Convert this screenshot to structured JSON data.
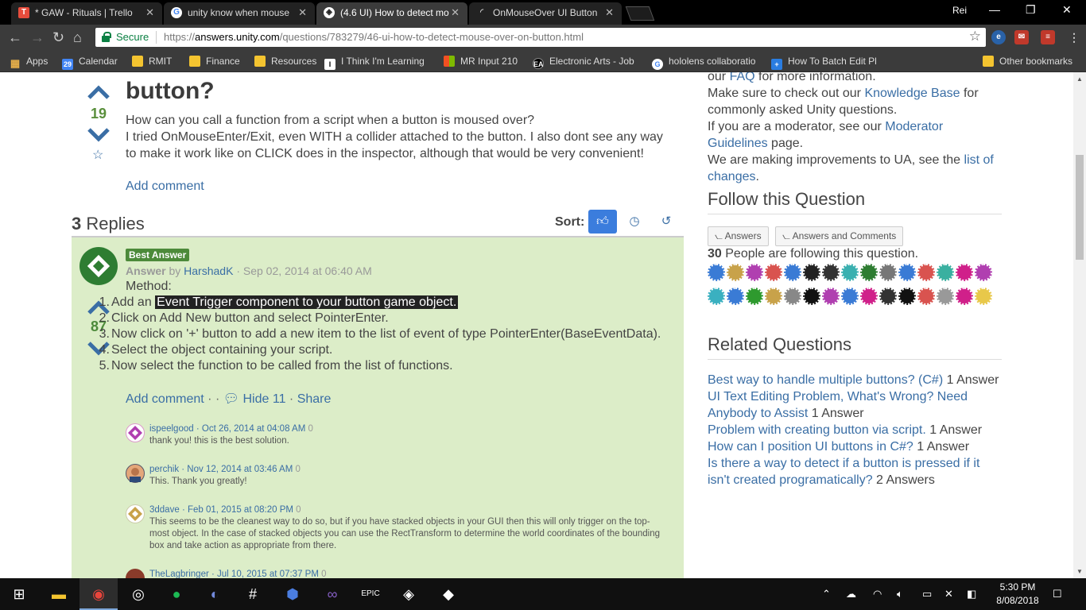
{
  "browser": {
    "tabs": [
      {
        "title": "* GAW - Rituals | Trello",
        "icon": "trello-icon",
        "color": "#e74c3c"
      },
      {
        "title": "unity know when mouse",
        "icon": "google-icon",
        "color": "#4285f4"
      },
      {
        "title": "(4.6 UI) How to detect mo",
        "icon": "unity-icon",
        "color": "#222222"
      },
      {
        "title": "OnMouseOver UI Button",
        "icon": "loading-icon",
        "color": "#222222"
      }
    ],
    "profile_name": "Rei",
    "secure_label": "Secure",
    "url": {
      "scheme": "https://",
      "host": "answers.unity.com",
      "path": "/questions/783279/46-ui-how-to-detect-mouse-over-on-button.html"
    },
    "bookmarks": [
      {
        "label": "Apps",
        "icon": "apps-grid-icon"
      },
      {
        "label": "Calendar",
        "icon": "calendar-icon"
      },
      {
        "label": "RMIT",
        "icon": "folder-icon"
      },
      {
        "label": "Finance",
        "icon": "folder-icon"
      },
      {
        "label": "Resources",
        "icon": "folder-icon"
      },
      {
        "label": "I Think I'm Learning",
        "icon": "bookmark-icon"
      },
      {
        "label": "MR Input 210",
        "icon": "microsoft-icon"
      },
      {
        "label": "Electronic Arts - Job",
        "icon": "ea-icon"
      },
      {
        "label": "hololens collaboratio",
        "icon": "google-icon"
      },
      {
        "label": "How To Batch Edit Pl",
        "icon": "plus-icon"
      },
      {
        "label": "Other bookmarks",
        "icon": "folder-icon"
      }
    ]
  },
  "question": {
    "title_fragment": "button?",
    "score": "19",
    "body_lines": [
      "How can you call a function from a script when a button is moused over?",
      "I tried OnMouseEnter/Exit, even WITH a collider attached to the button. I also dont see any way to make it work like on CLICK does in the inspector, although that would be very convenient!"
    ],
    "add_comment": "Add comment"
  },
  "replies": {
    "count": "3",
    "label": "Replies",
    "sort_label": "Sort:"
  },
  "answer": {
    "badge": "Best Answer",
    "type": "Answer",
    "by": "by",
    "author": "HarshadK",
    "date": "· Sep 02, 2014 at 06:40 AM",
    "score": "87",
    "intro": "Method:",
    "steps": [
      {
        "n": "1.",
        "pre": "Add an ",
        "hl": "Event Trigger component to your button game object."
      },
      {
        "n": "2.",
        "pre": "Click on Add New button and select PointerEnter.",
        "hl": ""
      },
      {
        "n": "3.",
        "pre": "Now click on '+' button to add a new item to the list of event of type PointerEnter(BaseEventData).",
        "hl": ""
      },
      {
        "n": "4.",
        "pre": "Select the object containing your script.",
        "hl": ""
      },
      {
        "n": "5.",
        "pre": "Now select the function to be called from the list of functions.",
        "hl": ""
      }
    ],
    "add_comment": "Add comment",
    "hide": "Hide 11",
    "share": "Share"
  },
  "comments": [
    {
      "user": "ispeelgood",
      "date": "· Oct 26, 2014 at 04:08 AM",
      "votes": "0",
      "text": "thank you! this is the best solution."
    },
    {
      "user": "perchik",
      "date": "· Nov 12, 2014 at 03:46 AM",
      "votes": "0",
      "text": "This. Thank you greatly!"
    },
    {
      "user": "3ddave",
      "date": "· Feb 01, 2015 at 08:20 PM",
      "votes": "0",
      "text": "This seems to be the cleanest way to do so, but if you have stacked objects in your GUI then this will only trigger on the top-most object. In the case of stacked objects you can use the RectTransform to determine the world coordinates of the bounding box and take action as appropriate from there."
    },
    {
      "user": "TheLagbringer",
      "date": "· Jul 10, 2015 at 07:37 PM",
      "votes": "0",
      "text": ""
    }
  ],
  "sidebar": {
    "faq_line": {
      "pre": "our ",
      "link": "FAQ",
      "post": " for more information."
    },
    "kb_line": {
      "pre": "Make sure to check out our ",
      "link": "Knowledge Base",
      "post": " for commonly asked Unity questions."
    },
    "mod_line": {
      "pre": "If you are a moderator, see our ",
      "link": "Moderator Guidelines",
      "post": " page."
    },
    "changes_line": {
      "pre": "We are making improvements to UA, see the ",
      "link": "list of changes",
      "post": "."
    },
    "follow_title": "Follow this Question",
    "rss_answers": "Answers",
    "rss_answers_comments": "Answers and Comments",
    "followers_count": "30",
    "followers_text": "People are following this question.",
    "related_title": "Related Questions",
    "related": [
      {
        "link": "Best way to handle multiple buttons? (C#)",
        "count": "1 Answer"
      },
      {
        "link": "UI Text Editing Problem, What's Wrong? Need Anybody to Assist",
        "count": "1 Answer"
      },
      {
        "link": "Problem with creating button via script.",
        "count": "1 Answer"
      },
      {
        "link": "How can I position UI buttons in C#?",
        "count": "1 Answer"
      },
      {
        "link": "Is there a way to detect if a button is pressed if it isn't created programatically?",
        "count": "2 Answers"
      }
    ]
  },
  "taskbar": {
    "time": "5:30 PM",
    "date": "8/08/2018"
  },
  "colors": {
    "accent_link": "#3a6ea5",
    "answer_bg": "#dcedc8",
    "best_badge": "#4c8a3a",
    "sort_active": "#3b7ddd"
  }
}
